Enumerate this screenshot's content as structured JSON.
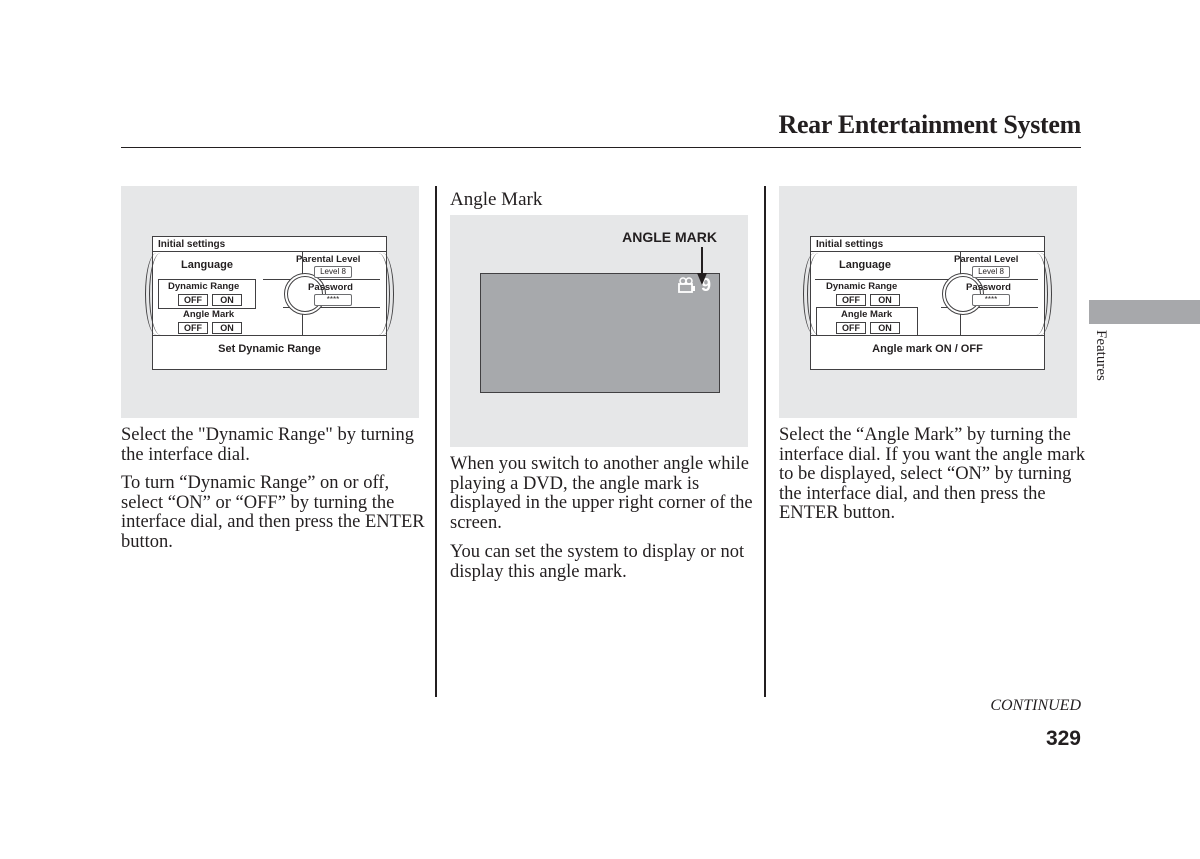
{
  "header": {
    "title": "Rear Entertainment System"
  },
  "side_tab": {
    "label": "Features"
  },
  "colors": {
    "figure_bg": "#e6e7e8",
    "screen_gray": "#a7a9ac",
    "tab_gray": "#a7a8ab",
    "text": "#231f20"
  },
  "figures": [
    {
      "panel_title": "Initial settings",
      "language": "Language",
      "parental_level": "Parental Level",
      "parental_value": "Level 8",
      "dynamic_range": "Dynamic Range",
      "password": "Password",
      "password_value": "****",
      "angle_mark": "Angle Mark",
      "off": "OFF",
      "on": "ON",
      "selected": "Dynamic Range",
      "footer": "Set Dynamic Range"
    },
    {
      "section_title": "Angle Mark",
      "callout_label": "ANGLE MARK",
      "icon": "camera-angle-icon",
      "angle_number": "9"
    },
    {
      "panel_title": "Initial settings",
      "language": "Language",
      "parental_level": "Parental Level",
      "parental_value": "Level 8",
      "dynamic_range": "Dynamic Range",
      "password": "Password",
      "password_value": "****",
      "angle_mark": "Angle Mark",
      "off": "OFF",
      "on": "ON",
      "selected": "Angle Mark",
      "footer": "Angle mark ON / OFF"
    }
  ],
  "columns": {
    "left": [
      "Select the \"Dynamic Range\" by turning the interface dial.",
      "To turn “Dynamic Range” on or off, select “ON” or “OFF” by turning the interface dial, and then press the ENTER button."
    ],
    "middle": [
      "When you switch to another angle while playing a DVD, the angle mark is displayed in the upper right corner of the screen.",
      "You can set the system to display or not display this angle mark."
    ],
    "right": [
      "Select the “Angle Mark” by turning the interface dial. If you want the angle mark to be displayed, select “ON” by turning the interface dial, and then press the ENTER button."
    ]
  },
  "footer": {
    "continued": "CONTINUED",
    "page_number": "329"
  }
}
